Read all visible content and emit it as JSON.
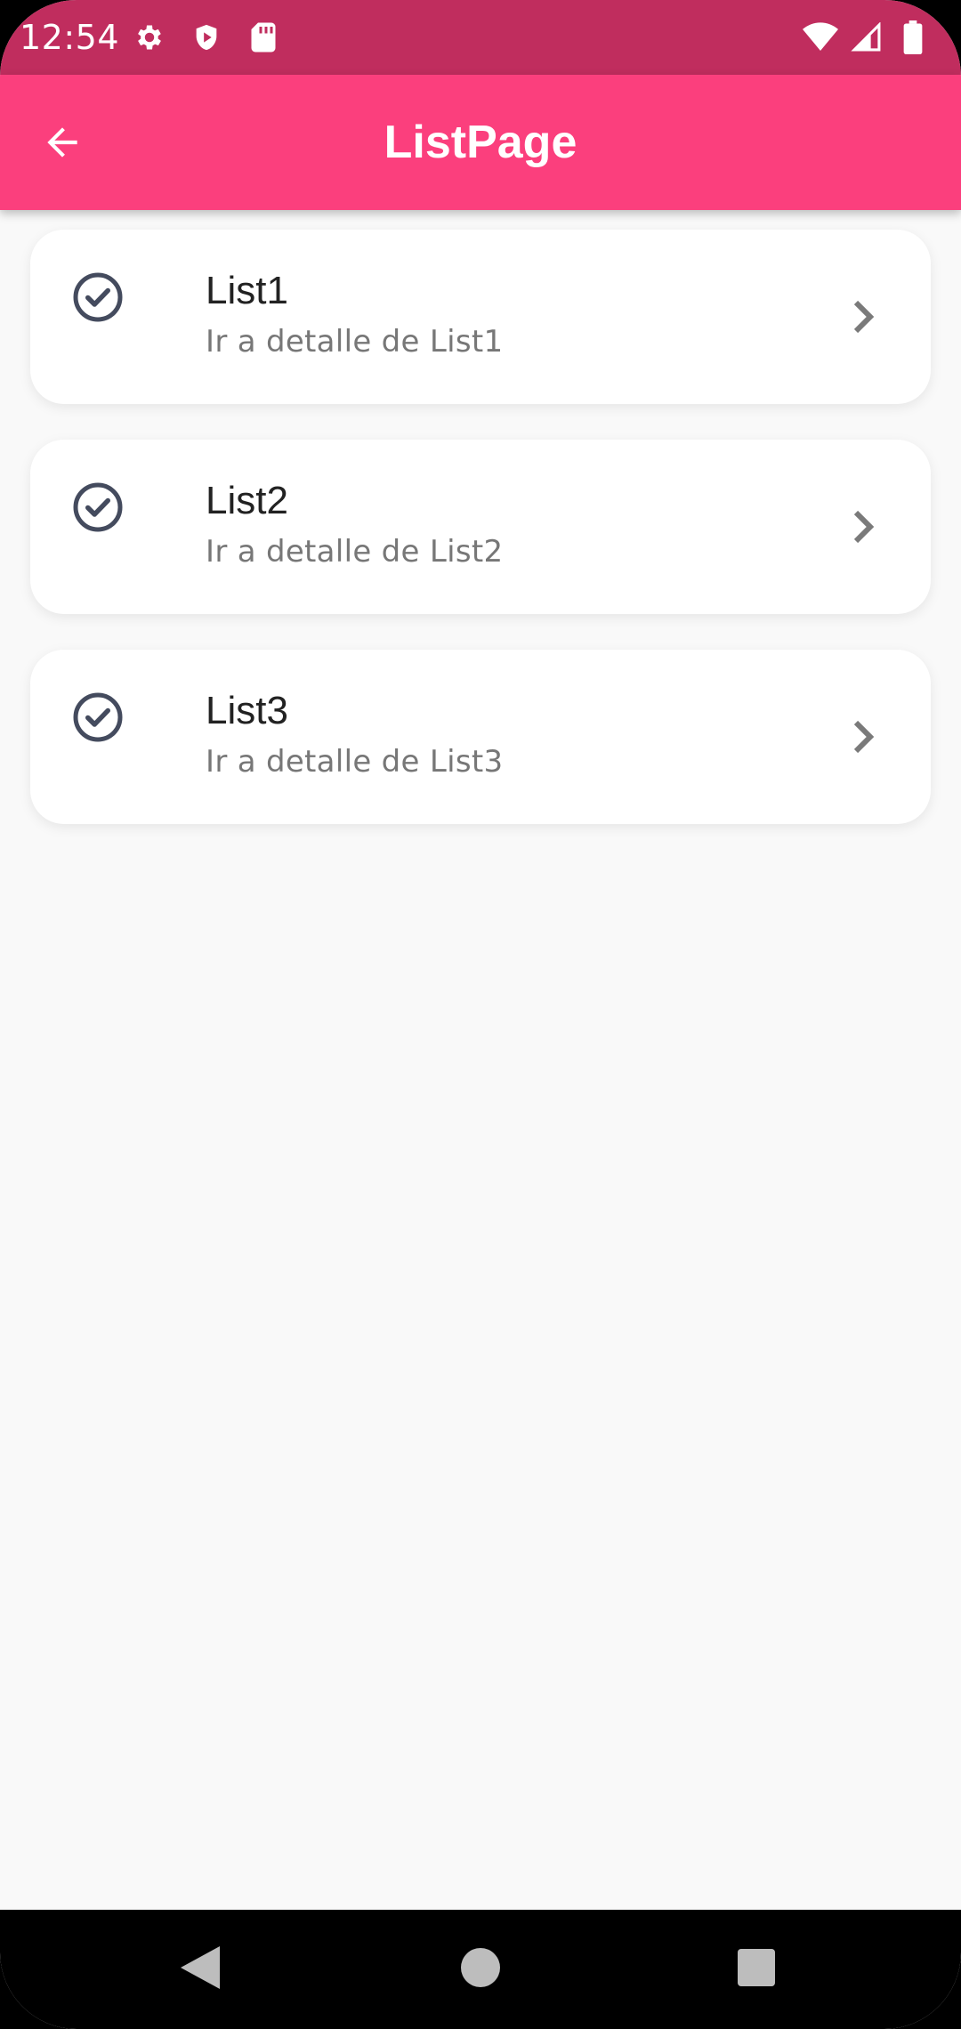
{
  "status_bar": {
    "time": "12:54",
    "left_icons": [
      "gear-icon",
      "shield-play-icon",
      "sd-card-icon"
    ],
    "right_icons": [
      "wifi-icon",
      "signal-icon",
      "battery-icon"
    ]
  },
  "app_bar": {
    "title": "ListPage",
    "back_icon": "arrow-left-icon"
  },
  "list": {
    "items": [
      {
        "title": "List1",
        "subtitle": "Ir a detalle de List1",
        "leading_icon": "check-circle-icon",
        "trailing_icon": "chevron-right-icon"
      },
      {
        "title": "List2",
        "subtitle": "Ir a detalle de List2",
        "leading_icon": "check-circle-icon",
        "trailing_icon": "chevron-right-icon"
      },
      {
        "title": "List3",
        "subtitle": "Ir a detalle de List3",
        "leading_icon": "check-circle-icon",
        "trailing_icon": "chevron-right-icon"
      }
    ]
  },
  "nav_bar": {
    "buttons": [
      "back-triangle-icon",
      "home-circle-icon",
      "recents-square-icon"
    ]
  },
  "colors": {
    "status_bar": "#c02d5e",
    "app_bar": "#fb3f7d",
    "background": "#f9f9f9",
    "icon_dark": "#444b5e",
    "chevron": "#7a7a7a"
  }
}
